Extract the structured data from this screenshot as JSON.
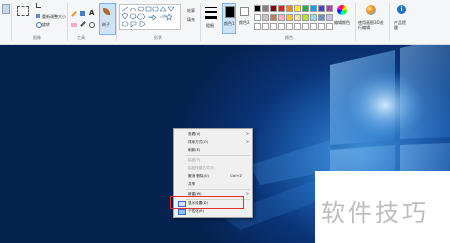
{
  "ribbon": {
    "image_group_label": "图像",
    "tools_group_label": "工具",
    "shapes_group_label": "形状",
    "colors_group_label": "颜色",
    "resize_label": "重新调整大小",
    "rotate_label": "旋转",
    "brush_label": "刷子",
    "outline_label": "轮廓",
    "fill_label": "填充",
    "size_label": "粗细",
    "color1_label": "颜色1",
    "color2_label": "颜色2",
    "edit_colors_label": "编辑颜色",
    "paint3d_label": "使用画图3D进行编辑",
    "product_alert_label": "产品提醒"
  },
  "context_menu": {
    "items": [
      {
        "label": "查看(V)",
        "arrow": ">"
      },
      {
        "label": "排序方式(O)",
        "arrow": ">"
      },
      {
        "label": "刷新(E)"
      },
      {
        "label": "粘贴(P)"
      },
      {
        "label": "粘贴快捷方式(S)"
      },
      {
        "label": "撤消 删除(U)",
        "shortcut": "Ctrl+Z"
      },
      {
        "label": "共享"
      },
      {
        "label": "新建(W)",
        "arrow": ">"
      },
      {
        "label": "显示设置(D)"
      },
      {
        "label": "个性化(R)"
      }
    ]
  },
  "watermark": "软件技巧",
  "colors": {
    "palette_row1": [
      "#000000",
      "#7f7f7f",
      "#880015",
      "#ed1c24",
      "#ff7f27",
      "#fff200",
      "#22b14c",
      "#00a2e8",
      "#3f48cc",
      "#a349a4"
    ],
    "palette_row2": [
      "#ffffff",
      "#c3c3c3",
      "#b97a57",
      "#ffaec9",
      "#ffc90e",
      "#efe4b0",
      "#b5e61d",
      "#99d9ea",
      "#7092be",
      "#c8bfe7"
    ],
    "color1": "#000000",
    "color2": "#ffffff"
  }
}
